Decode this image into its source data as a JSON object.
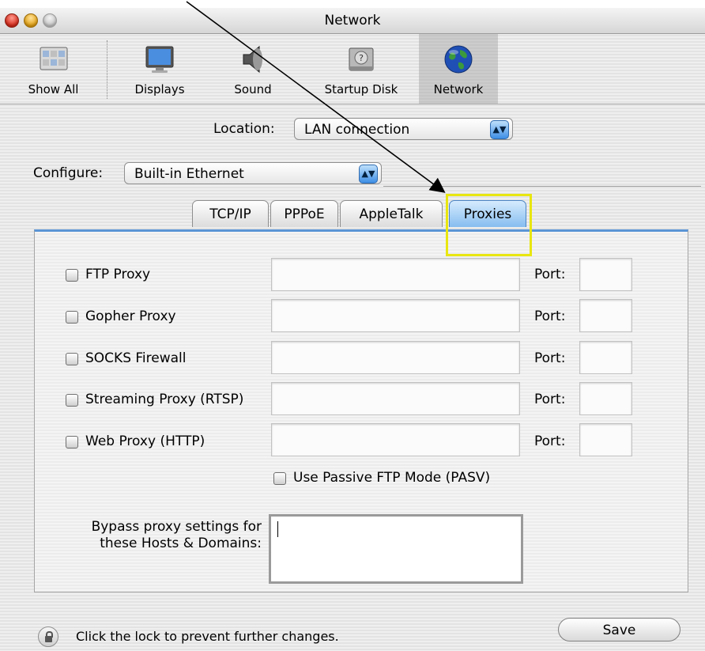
{
  "window": {
    "title": "Network"
  },
  "toolbar": {
    "items": [
      {
        "label": "Show All",
        "icon": "show-all-icon"
      },
      {
        "label": "Displays",
        "icon": "displays-icon"
      },
      {
        "label": "Sound",
        "icon": "sound-icon"
      },
      {
        "label": "Startup Disk",
        "icon": "startup-disk-icon"
      },
      {
        "label": "Network",
        "icon": "network-globe-icon",
        "selected": true
      }
    ]
  },
  "location": {
    "label": "Location:",
    "value": "LAN connection"
  },
  "configure": {
    "label": "Configure:",
    "value": "Built-in Ethernet"
  },
  "tabs": [
    {
      "label": "TCP/IP"
    },
    {
      "label": "PPPoE"
    },
    {
      "label": "AppleTalk"
    },
    {
      "label": "Proxies",
      "active": true
    }
  ],
  "proxies": {
    "port_label": "Port:",
    "rows": [
      {
        "label": "FTP Proxy",
        "checked": false,
        "server": "",
        "port": ""
      },
      {
        "label": "Gopher Proxy",
        "checked": false,
        "server": "",
        "port": ""
      },
      {
        "label": "SOCKS Firewall",
        "checked": false,
        "server": "",
        "port": ""
      },
      {
        "label": "Streaming Proxy (RTSP)",
        "checked": false,
        "server": "",
        "port": ""
      },
      {
        "label": "Web Proxy (HTTP)",
        "checked": false,
        "server": "",
        "port": ""
      }
    ],
    "passive_ftp": {
      "label": "Use Passive FTP Mode (PASV)",
      "checked": false
    },
    "bypass": {
      "label_line1": "Bypass proxy settings for",
      "label_line2": "these Hosts & Domains:",
      "value": ""
    }
  },
  "footer": {
    "lock_text": "Click the lock to prevent further changes.",
    "save_label": "Save"
  },
  "annotation": {
    "highlight_color": "#e8e610",
    "arrow_color": "#000000"
  },
  "colors": {
    "accent_blue": "#5b95d6",
    "selected_tab": "#86bdf0"
  }
}
